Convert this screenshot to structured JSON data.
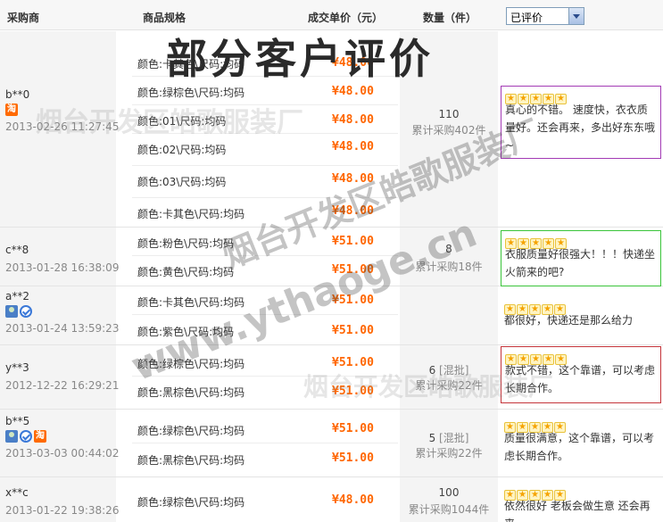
{
  "header": {
    "col_buyer": "采购商",
    "col_spec": "商品规格",
    "col_price": "成交单价（元）",
    "col_qty": "数量（件）",
    "filter_selected": "已评价"
  },
  "overlay_title": "部分客户评价",
  "watermarks": {
    "wm1": "烟台开发区皓歌服装厂",
    "wm2": "烟台开发区皓歌服装厂",
    "wm3": "www.ythaoge.cn",
    "wm4": "烟台开发区皓歌服装厂"
  },
  "orders": [
    {
      "buyer": "b**0",
      "date": "2013-02-26 11:27:45",
      "badges": [
        "tao"
      ],
      "items": [
        {
          "spec": "颜色:卡其色\\尺码:均码",
          "price": "¥48.00"
        },
        {
          "spec": "颜色:绿棕色\\尺码:均码",
          "price": "¥48.00"
        },
        {
          "spec": "颜色:01\\尺码:均码",
          "price": "¥48.00"
        },
        {
          "spec": "颜色:02\\尺码:均码",
          "price": "¥48.00"
        },
        {
          "spec": "颜色:03\\尺码:均码",
          "price": "¥48.00"
        },
        {
          "spec": "颜色:卡其色\\尺码:均码",
          "price": "¥48.00"
        }
      ],
      "qty": "110",
      "qty_note": "",
      "total": "累计采购402件",
      "review": "真心的不错。 速度快，衣衣质量好。还会再来，多出好东东哦~",
      "stars": 5,
      "border": "#a33bb5"
    },
    {
      "buyer": "c**8",
      "date": "2013-01-28 16:38:09",
      "badges": [],
      "items": [
        {
          "spec": "颜色:粉色\\尺码:均码",
          "price": "¥51.00"
        },
        {
          "spec": "颜色:黄色\\尺码:均码",
          "price": "¥51.00"
        }
      ],
      "qty": "8",
      "qty_note": "",
      "total": "累计采购18件",
      "review": "衣服质量好很强大！！！快递坐火箭来的吧?",
      "stars": 5,
      "border": "#3ac43a"
    },
    {
      "buyer": "a**2",
      "date": "2013-01-24 13:59:23",
      "badges": [
        "user",
        "v"
      ],
      "items": [
        {
          "spec": "颜色:卡其色\\尺码:均码",
          "price": "¥51.00"
        },
        {
          "spec": "颜色:紫色\\尺码:均码",
          "price": "¥51.00"
        }
      ],
      "qty": "",
      "qty_note": "",
      "total": "",
      "review": "都很好，快递还是那么给力",
      "stars": 5,
      "border": ""
    },
    {
      "buyer": "y**3",
      "date": "2012-12-22 16:29:21",
      "badges": [],
      "items": [
        {
          "spec": "颜色:绿棕色\\尺码:均码",
          "price": "¥51.00"
        },
        {
          "spec": "颜色:黑棕色\\尺码:均码",
          "price": "¥51.00"
        }
      ],
      "qty": "6",
      "qty_note": "[混批]",
      "total": "累计采购22件",
      "review": "款式不错，这个靠谱，可以考虑长期合作。",
      "stars": 5,
      "border": "#c4343a"
    },
    {
      "buyer": "b**5",
      "date": "2013-03-03 00:44:02",
      "badges": [
        "user",
        "v",
        "tao"
      ],
      "items": [
        {
          "spec": "颜色:绿棕色\\尺码:均码",
          "price": "¥51.00"
        },
        {
          "spec": "颜色:黑棕色\\尺码:均码",
          "price": "¥51.00"
        }
      ],
      "qty": "5",
      "qty_note": "[混批]",
      "total": "累计采购22件",
      "review": "质量很满意，这个靠谱，可以考虑长期合作。",
      "stars": 5,
      "border": ""
    },
    {
      "buyer": "x**c",
      "date": "2013-01-22 19:38:26",
      "badges": [],
      "items": [
        {
          "spec": "颜色:绿棕色\\尺码:均码",
          "price": "¥48.00"
        }
      ],
      "qty": "100",
      "qty_note": "",
      "total": "累计采购1044件",
      "review": "依然很好 老板会做生意 还会再来",
      "stars": 5,
      "border": ""
    }
  ]
}
